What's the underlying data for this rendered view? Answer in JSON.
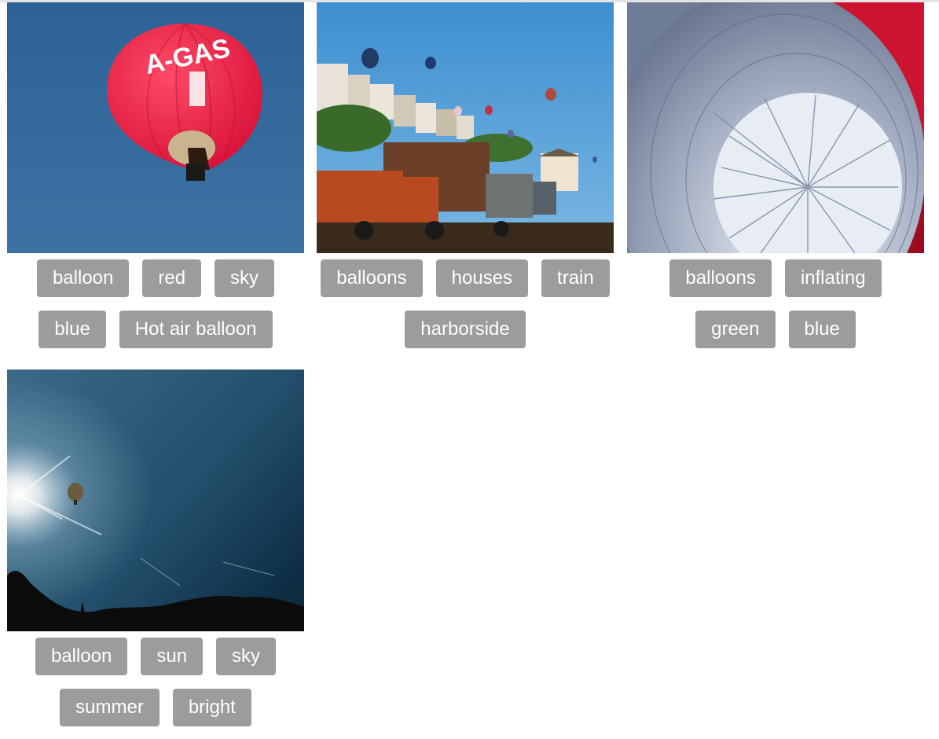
{
  "gallery": {
    "items": [
      {
        "photo_name": "red-hot-air-balloon-photo",
        "tags": [
          "balloon",
          "red",
          "sky",
          "blue",
          "Hot air balloon"
        ],
        "balloon_text": "A-GAS"
      },
      {
        "photo_name": "harborside-train-balloons-photo",
        "tags": [
          "balloons",
          "houses",
          "train",
          "harborside"
        ]
      },
      {
        "photo_name": "inflating-balloons-photo",
        "tags": [
          "balloons",
          "inflating",
          "green",
          "blue"
        ]
      },
      {
        "photo_name": "balloon-sun-sky-photo",
        "tags": [
          "balloon",
          "sun",
          "sky",
          "summer",
          "bright"
        ]
      }
    ]
  },
  "colors": {
    "tag_background": "#9c9c9c",
    "tag_text": "#ffffff",
    "page_background": "#ffffff"
  }
}
